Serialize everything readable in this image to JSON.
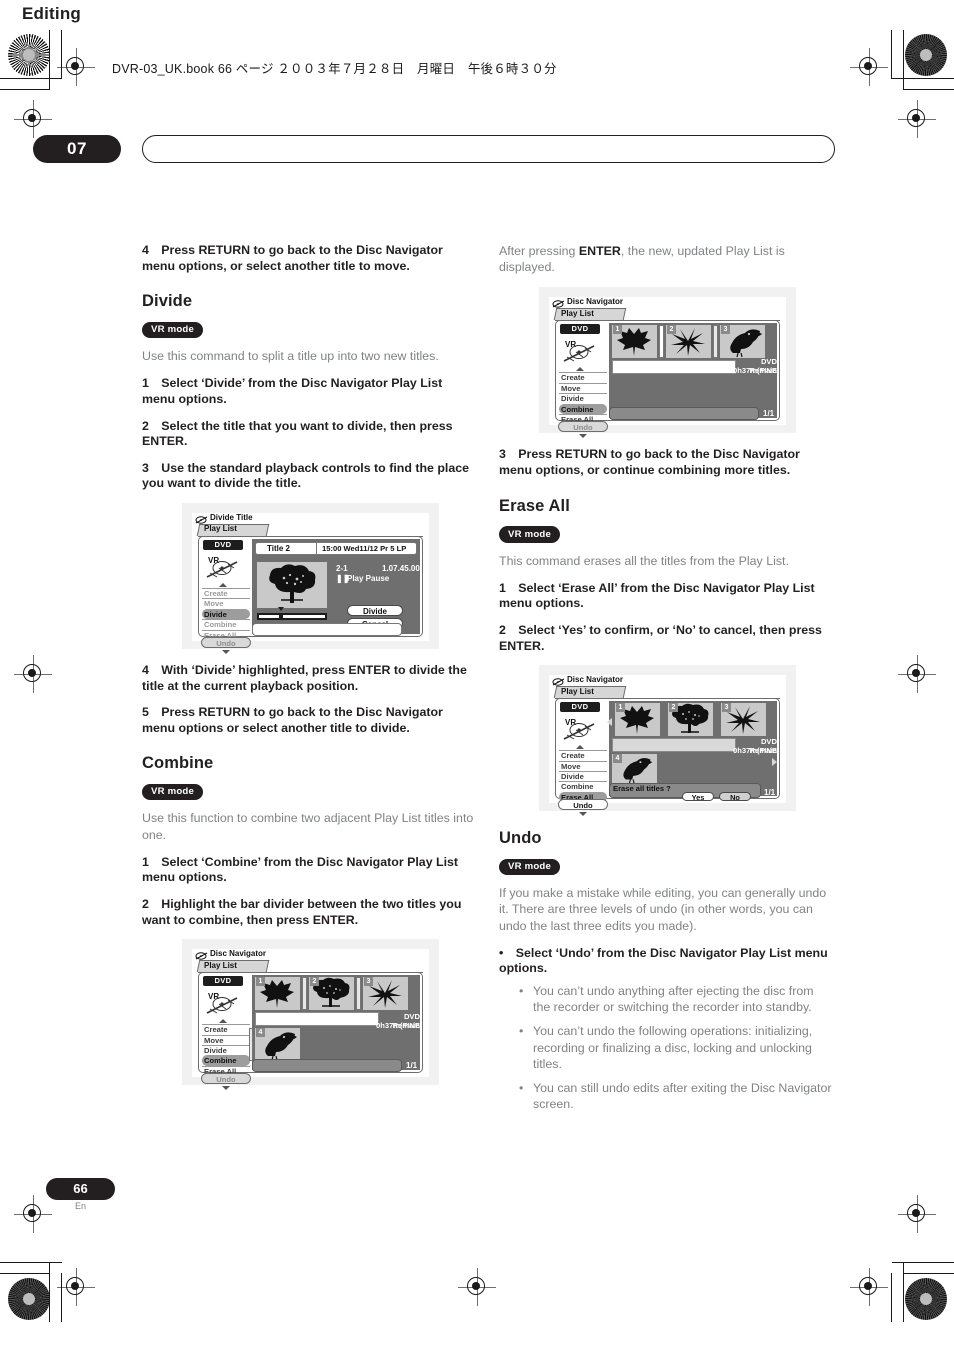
{
  "running_head": "DVR-03_UK.book  66 ページ  ２００３年７月２８日　月曜日　午後６時３０分",
  "chapter": {
    "number": "07",
    "title": "Editing"
  },
  "footer": {
    "page": "66",
    "lang": "En"
  },
  "left_column": {
    "step_move_4": "4 Press RETURN to go back to the Disc Navigator menu options, or select another title to move.",
    "divide": {
      "heading": "Divide",
      "badge": "VR mode",
      "intro": "Use this command to split a title up into two new titles.",
      "step1": "1 Select ‘Divide’ from the Disc Navigator Play List menu options.",
      "step2": "2 Select the title that you want to divide, then press ENTER.",
      "step3": "3 Use the standard playback controls to find the place you want to divide the title.",
      "step4": "4 With ‘Divide’ highlighted, press ENTER to divide the title at the current playback position.",
      "step5": "5 Press RETURN to go back to the Disc Navigator menu options or select another title to divide."
    },
    "combine": {
      "heading": "Combine",
      "badge": "VR mode",
      "intro": "Use this function to combine two adjacent Play List titles into one.",
      "step1": "1 Select ‘Combine’ from the Disc Navigator Play List menu options.",
      "step2": "2 Highlight the bar divider between the two titles you want to combine, then press ENTER."
    }
  },
  "right_column": {
    "after_enter_pre": "After pressing ",
    "after_enter_bold": "ENTER",
    "after_enter_post": ", the new, updated Play List is displayed.",
    "combine_step3": "3 Press RETURN to go back to the Disc Navigator menu options, or continue combining more titles.",
    "erase_all": {
      "heading": "Erase All",
      "badge": "VR mode",
      "intro": "This command erases all the titles from the Play List.",
      "step1": "1 Select ‘Erase All’ from the Disc Navigator Play List menu options.",
      "step2": "2 Select ‘Yes’ to confirm, or ‘No’ to cancel, then press ENTER."
    },
    "undo": {
      "heading": "Undo",
      "badge": "VR mode",
      "intro": "If you make a mistake while editing, you can generally undo it. There are three levels of undo (in other words, you can undo the last three edits you made).",
      "bullet": "• Select ‘Undo’ from the Disc Navigator Play List menu options.",
      "sub1": "You can’t undo anything after ejecting the disc from the recorder or switching the recorder into standby.",
      "sub2": "You can’t undo the following operations: initializing, recording or finalizing a disc, locking and unlocking titles.",
      "sub3": "You can still undo edits after exiting the Disc Navigator screen."
    }
  },
  "figures": {
    "divide_title": {
      "screen_title": "Divide Title",
      "tab": "Play List",
      "disc_chip": "DVD",
      "menu": [
        "Create",
        "Move",
        "Divide",
        "Combine",
        "Erase All"
      ],
      "selected_menu": "Divide",
      "undo_label": "Undo",
      "title_name": "Title 2",
      "title_info": "15:00 Wed11/12  Pr 5   LP",
      "chapter_index": "2-1",
      "timecode": "1.07.45.00",
      "transport_state": "Play Pause",
      "buttons": [
        "Divide",
        "Cancel"
      ]
    },
    "combine_before": {
      "screen_title": "Disc Navigator",
      "tab": "Play List",
      "disc_chip": "DVD",
      "menu": [
        "Create",
        "Move",
        "Divide",
        "Combine",
        "Erase All"
      ],
      "selected_menu": "Combine",
      "undo_label": "Undo",
      "thumbs": [
        {
          "num": "1",
          "icon": "maple-leaf"
        },
        {
          "num": "2",
          "icon": "tree"
        },
        {
          "num": "3",
          "icon": "lily-flower"
        },
        {
          "num": "4",
          "icon": "toucan"
        }
      ],
      "remain_label": "DVD Remain",
      "remain_value": "0h37m(FINE)",
      "pager": "1/1"
    },
    "combine_after": {
      "screen_title": "Disc Navigator",
      "tab": "Play List",
      "disc_chip": "DVD",
      "menu": [
        "Create",
        "Move",
        "Divide",
        "Combine",
        "Erase All"
      ],
      "selected_menu": "Combine",
      "undo_label": "Undo",
      "thumbs": [
        {
          "num": "1",
          "icon": "maple-leaf"
        },
        {
          "num": "2",
          "icon": "lily-flower"
        },
        {
          "num": "3",
          "icon": "toucan"
        }
      ],
      "remain_label": "DVD Remain",
      "remain_value": "0h37m(FINE)",
      "pager": "1/1"
    },
    "erase_all": {
      "screen_title": "Disc Navigator",
      "tab": "Play List",
      "disc_chip": "DVD",
      "menu": [
        "Create",
        "Move",
        "Divide",
        "Combine",
        "Erase All"
      ],
      "selected_menu": "Erase All",
      "undo_label": "Undo",
      "thumbs": [
        {
          "num": "1",
          "icon": "maple-leaf"
        },
        {
          "num": "2",
          "icon": "tree"
        },
        {
          "num": "3",
          "icon": "lily-flower"
        },
        {
          "num": "4",
          "icon": "toucan"
        }
      ],
      "remain_label": "DVD Remain",
      "remain_value": "0h37m(FINE)",
      "prompt": "Erase all titles ?",
      "yes_label": "Yes",
      "no_label": "No",
      "pager": "1/1"
    }
  },
  "colors": {
    "ink": "#231f20",
    "body_gray": "#808285",
    "osd_gray": "#6f6f6f"
  }
}
